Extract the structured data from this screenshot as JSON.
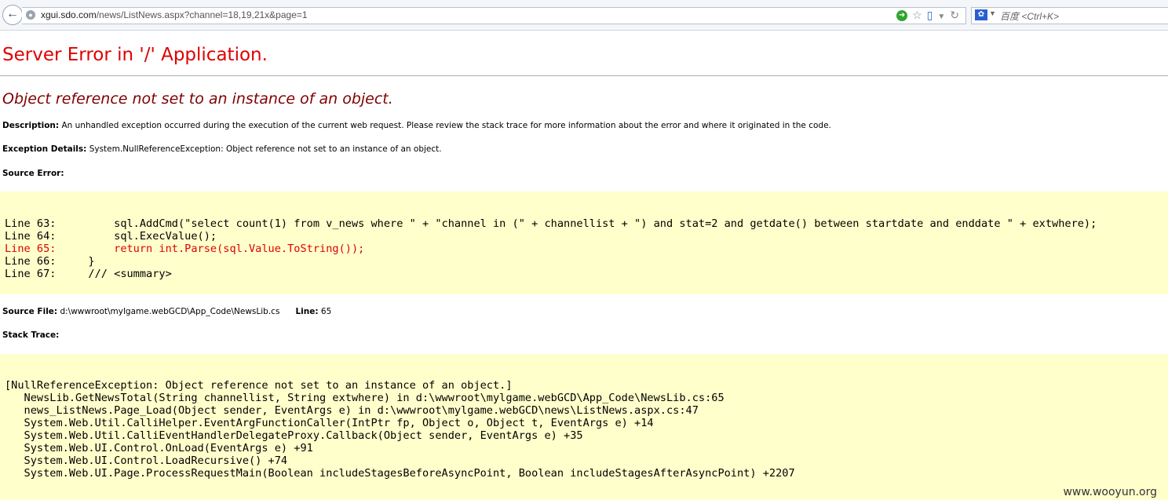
{
  "browser": {
    "url_host": "xgui.sdo.com",
    "url_rest": "/news/ListNews.aspx?channel=18,19,21x&page=1",
    "search_placeholder": "百度 <Ctrl+K>"
  },
  "page": {
    "title": "Server Error in '/' Application.",
    "error_message": "Object reference not set to an instance of an object.",
    "description_label": "Description:",
    "description_text": "An unhandled exception occurred during the execution of the current web request. Please review the stack trace for more information about the error and where it originated in the code.",
    "exception_label": "Exception Details:",
    "exception_text": "System.NullReferenceException: Object reference not set to an instance of an object.",
    "source_error_label": "Source Error:",
    "source_lines": [
      "Line 63:         sql.AddCmd(\"select count(1) from v_news where \" + \"channel in (\" + channellist + \") and stat=2 and getdate() between startdate and enddate \" + extwhere);",
      "Line 64:         sql.ExecValue();"
    ],
    "source_error_line": "Line 65:         return int.Parse(sql.Value.ToString());",
    "source_lines_after": [
      "Line 66:     }",
      "Line 67:     /// <summary>"
    ],
    "source_file_label": "Source File:",
    "source_file": "d:\\wwwroot\\mylgame.webGCD\\App_Code\\NewsLib.cs",
    "line_label": "Line:",
    "line_number": "65",
    "stack_trace_label": "Stack Trace:",
    "stack_trace": [
      "[NullReferenceException: Object reference not set to an instance of an object.]",
      "   NewsLib.GetNewsTotal(String channellist, String extwhere) in d:\\wwwroot\\mylgame.webGCD\\App_Code\\NewsLib.cs:65",
      "   news_ListNews.Page_Load(Object sender, EventArgs e) in d:\\wwwroot\\mylgame.webGCD\\news\\ListNews.aspx.cs:47",
      "   System.Web.Util.CalliHelper.EventArgFunctionCaller(IntPtr fp, Object o, Object t, EventArgs e) +14",
      "   System.Web.Util.CalliEventHandlerDelegateProxy.Callback(Object sender, EventArgs e) +35",
      "   System.Web.UI.Control.OnLoad(EventArgs e) +91",
      "   System.Web.UI.Control.LoadRecursive() +74",
      "   System.Web.UI.Page.ProcessRequestMain(Boolean includeStagesBeforeAsyncPoint, Boolean includeStagesAfterAsyncPoint) +2207"
    ]
  },
  "watermark": "www.wooyun.org",
  "colors": {
    "error_red": "#e00000",
    "message_maroon": "#800000",
    "code_bg": "#ffffcc"
  },
  "icons": [
    "back-arrow-icon",
    "globe-icon",
    "go-icon",
    "star-icon",
    "mobile-icon",
    "dropdown-icon",
    "reload-icon",
    "paw-icon"
  ]
}
